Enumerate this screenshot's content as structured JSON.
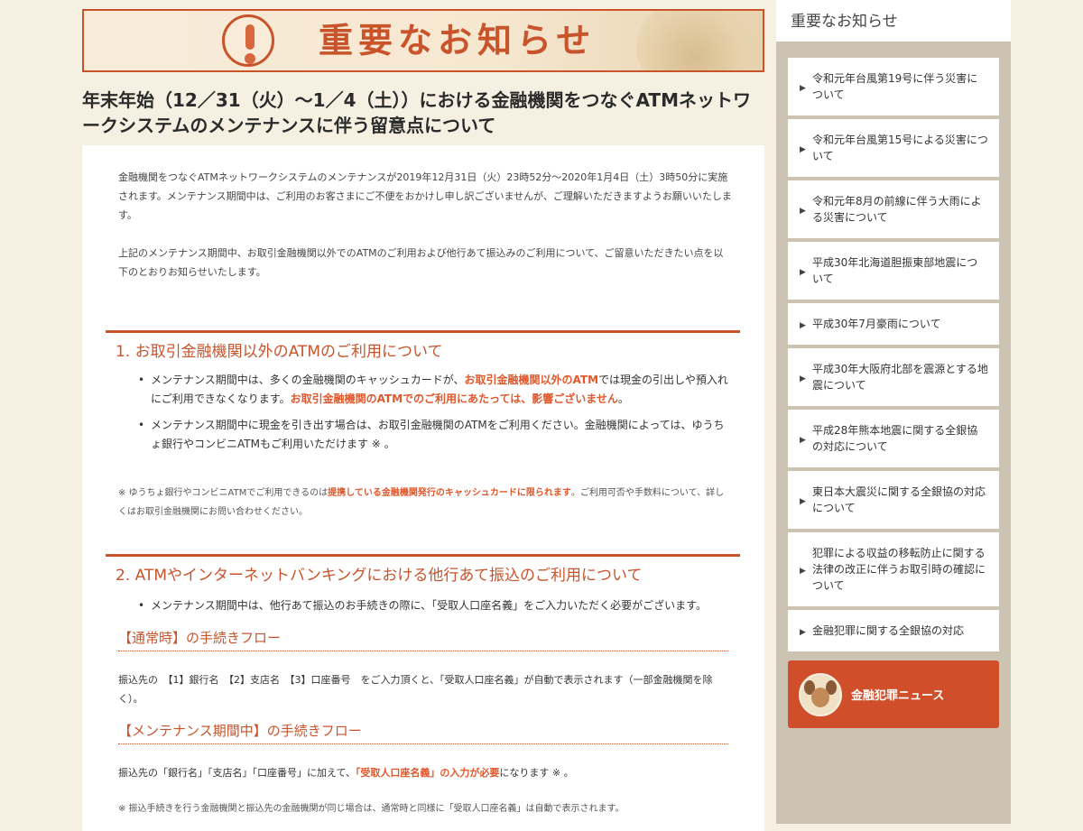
{
  "banner": {
    "title": "重要なお知らせ"
  },
  "page_title": "年末年始（12／31（火）～1／4（土））における金融機関をつなぐATMネットワークシステムのメンテナンスに伴う留意点について",
  "intro": {
    "p1": "金融機関をつなぐATMネットワークシステムのメンテナンスが2019年12月31日（火）23時52分～2020年1月4日（土）3時50分に実施されます。メンテナンス期間中は、ご利用のお客さまにご不便をおかけし申し訳ございませんが、ご理解いただきますようお願いいたします。",
    "p2": "上記のメンテナンス期間中、お取引金融機関以外でのATMのご利用および他行あて振込みのご利用について、ご留意いただきたい点を以下のとおりお知らせいたします。"
  },
  "section1": {
    "heading": "1.  お取引金融機関以外のATMのご利用について",
    "b1_a": "メンテナンス期間中は、多くの金融機関のキャッシュカードが、",
    "b1_em1": "お取引金融機関以外のATM",
    "b1_b": "では現金の引出しや預入れにご利用できなくなります。",
    "b1_em2": "お取引金融機関のATMでのご利用にあたっては、影響ございません",
    "b1_c": "。",
    "b2": "メンテナンス期間中に現金を引き出す場合は、お取引金融機関のATMをご利用ください。金融機関によっては、ゆうちょ銀行やコンビニATMもご利用いただけます ※ 。",
    "note_a": "※ ゆうちょ銀行やコンビニATMでご利用できるのは",
    "note_em": "提携している金融機関発行のキャッシュカードに限られます",
    "note_b": "。ご利用可否や手数料について、詳しくはお取引金融機関にお問い合わせください。"
  },
  "section2": {
    "heading": "2.  ATMやインターネットバンキングにおける他行あて振込のご利用について",
    "b1": "メンテナンス期間中は、他行あて振込のお手続きの際に、「受取人口座名義」をご入力いただく必要がございます。",
    "flow1_head": "【通常時】の手続きフロー",
    "flow1_text": "振込先の　【1】銀行名　【2】支店名　【3】口座番号　をご入力頂くと、「受取人口座名義」が自動で表示されます（一部金融機関を除く）。",
    "flow2_head": "【メンテナンス期間中】の手続きフロー",
    "flow2_a": "振込先の「銀行名」「支店名」「口座番号」に加えて、",
    "flow2_em": "「受取人口座名義」の入力が必要",
    "flow2_b": "になります ※ 。",
    "note": "※ 振込手続きを行う金融機関と振込先の金融機関が同じ場合は、通常時と同様に「受取人口座名義」は自動で表示されます。"
  },
  "sidebar": {
    "heading": "重要なお知らせ",
    "items": [
      "令和元年台風第19号に伴う災害について",
      "令和元年台風第15号による災害について",
      "令和元年8月の前線に伴う大雨による災害について",
      "平成30年北海道胆振東部地震について",
      "平成30年7月豪雨について",
      "平成30年大阪府北部を震源とする地震について",
      "平成28年熊本地震に関する全銀協の対応について",
      "東日本大震災に関する全銀協の対応について",
      "犯罪による収益の移転防止に関する法律の改正に伴うお取引時の確認について",
      "金融犯罪に関する全銀協の対応"
    ],
    "news_button": "金融犯罪ニュース"
  },
  "colors": {
    "accent": "#c9532b",
    "emphasis": "#e0582b",
    "sidebar_bg": "#cdc3b3",
    "page_bg": "#f5f0e1"
  }
}
